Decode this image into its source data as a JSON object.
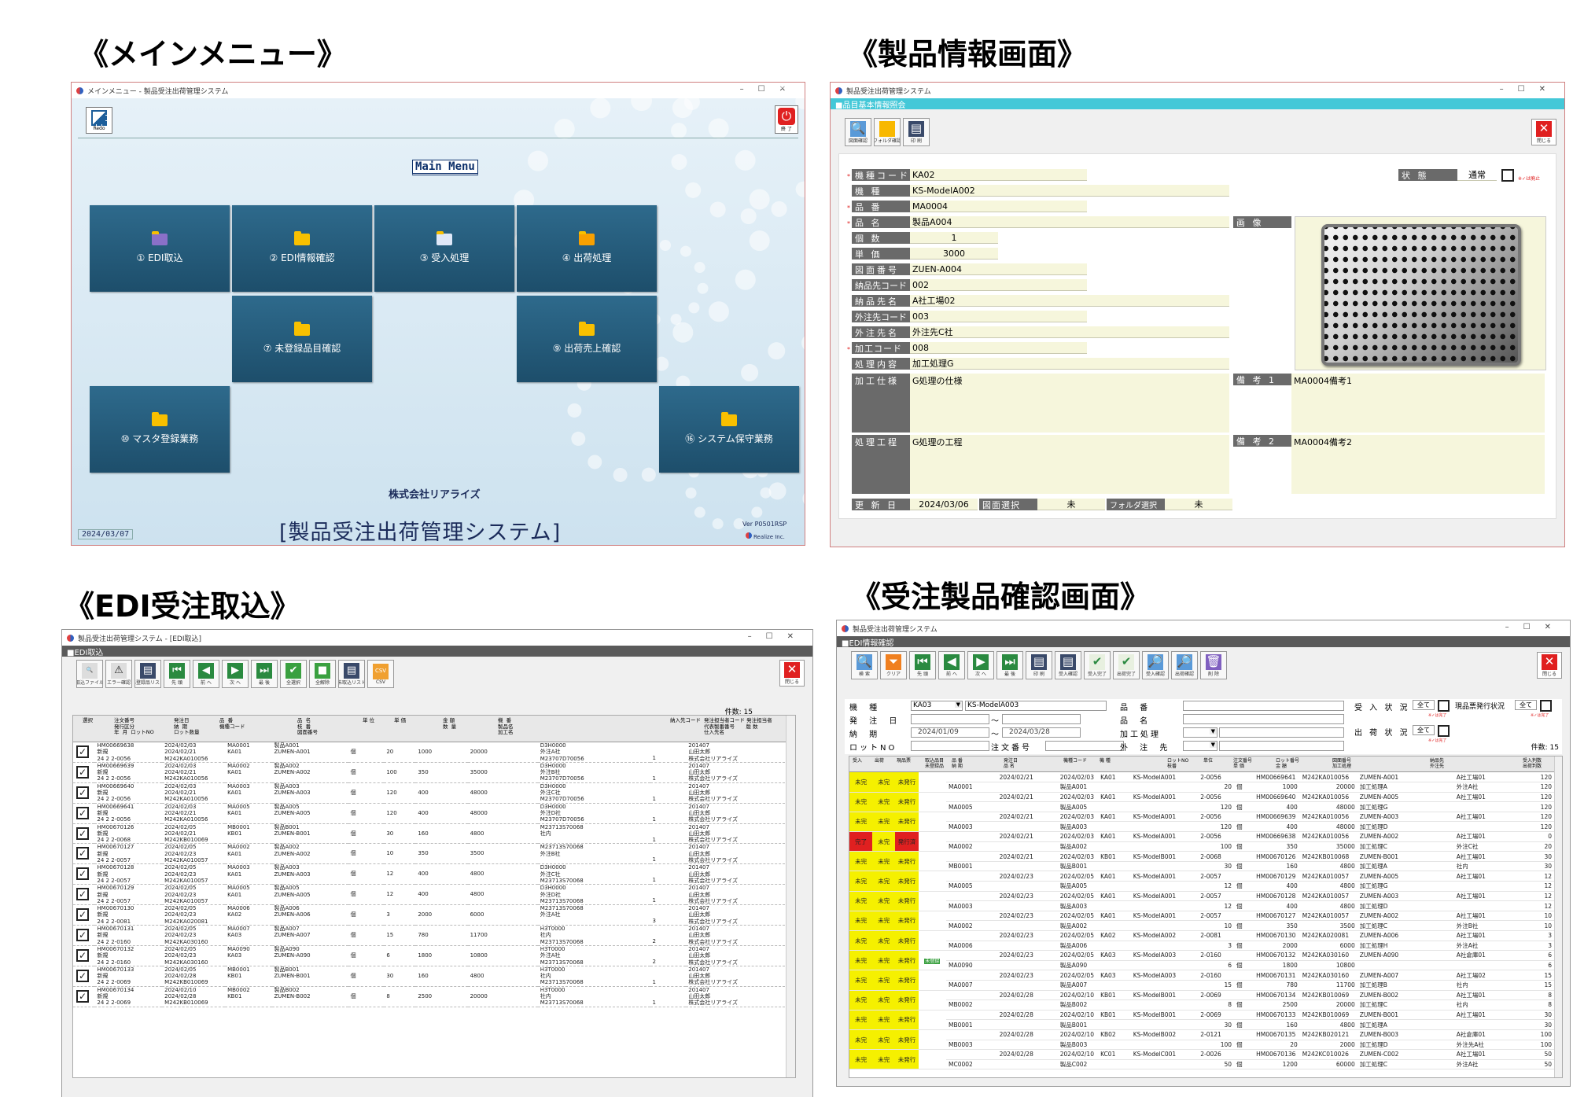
{
  "headings": {
    "main_menu": "《メインメニュー》",
    "product_info": "《製品情報画面》",
    "edi": "《EDI受注取込》",
    "confirm": "《受注製品確認画面》"
  },
  "main_menu": {
    "title": "メインメニュー - 製品受注出荷管理システム",
    "redo_label": "Redo",
    "exit_label": "終 了",
    "heading": "Main Menu",
    "tiles": [
      "① EDI取込",
      "② EDI情報確認",
      "③ 受入処理",
      "④ 出荷処理",
      "⑦ 未登録品目確認",
      "⑨ 出荷売上確認",
      "⑩ マスタ登録業務",
      "⑯ システム保守業務"
    ],
    "company": "株式会社リアライズ",
    "system_name": "[製品受注出荷管理システム]",
    "date": "2024/03/07",
    "version": "Ver P0501RSP",
    "brand": "Realize Inc."
  },
  "product": {
    "title": "製品受注出荷管理システム",
    "section": "■品目基本情報照会",
    "tools": [
      "図面確認",
      "フォルダ確認",
      "印 刷"
    ],
    "close_label": "閉じる",
    "labels": {
      "model_code": "機種コード",
      "model": "機 種",
      "part_no": "品 番",
      "name": "品 名",
      "qty": "個 数",
      "price": "単 価",
      "drawing_no": "図面番号",
      "dest_code": "納品先コード",
      "dest_name": "納品先名",
      "order_code": "外注先コード",
      "order_name": "外注先名",
      "proc_code": "加工コード",
      "proc_content": "処理内容",
      "spec": "加工仕様",
      "process": "処理工程",
      "updated": "更 新 日",
      "drawing_sel": "図面選択",
      "folder_sel": "フォルダ選択",
      "status": "状 態",
      "image": "画 像",
      "note1": "備 考 1",
      "note2": "備 考 2"
    },
    "values": {
      "model_code": "KA02",
      "model": "KS-ModelA002",
      "part_no": "MA0004",
      "name": "製品A004",
      "qty": "1",
      "price": "3000",
      "drawing_no": "ZUEN-A004",
      "dest_code": "002",
      "dest_name": "A社工場02",
      "order_code": "003",
      "order_name": "外注先C社",
      "proc_code": "008",
      "proc_content": "加工処理G",
      "spec": "G処理の仕様",
      "process": "G処理の工程",
      "updated": "2024/03/06",
      "drawing_sel": "未",
      "folder_sel": "未",
      "status": "通常",
      "status_note": "※✓は廃止",
      "note1": "MA0004備考1",
      "note2": "MA0004備考2"
    }
  },
  "edi": {
    "title": "製品受注出荷管理システム - [EDI取込]",
    "section": "■EDI取込",
    "tools": [
      "取込ファイル",
      "エラー確認",
      "未登録品リスト",
      "先 頭",
      "前 へ",
      "次 へ",
      "最 後",
      "全選択",
      "全解除",
      "未取込リスト",
      "CSV",
      "閉じる"
    ],
    "count": "件数: 15",
    "header_top": [
      "選択",
      "注文番号\n発行区分\n年  月  ロットNO",
      "発注日\n納  期\nロット数量",
      "品  番\n機種コード",
      "品  名\n枝  番\n図面番号",
      "単 位",
      "単 価",
      "金 額\n数  量",
      "機  番\n製品名\n加工名",
      "納入先コード",
      "発注担当者コード 発注担当者\n代表製番番号       版 数\n仕入先名"
    ],
    "rows": [
      [
        "HM00669638",
        "新規",
        "24  2  2-0056",
        "2024/02/03",
        "2024/02/21",
        "M242KA010056",
        "MA0001",
        "KA01",
        "製品A001",
        "ZUMEN-A001",
        "20",
        "1000",
        "20000",
        "D3H0000",
        "外注A社",
        "M23707D70056",
        "201407",
        "山田太郎",
        "株式会社リアライズ",
        "1",
        "2"
      ],
      [
        "HM00669639",
        "新規",
        "24  2  2-0056",
        "2024/02/03",
        "2024/02/21",
        "M242KA010056",
        "MA0002",
        "KA01",
        "製品A002",
        "ZUMEN-A002",
        "100",
        "350",
        "35000",
        "D3H0000",
        "外注B社",
        "M23707D70056",
        "201407",
        "山田太郎",
        "株式会社リアライズ",
        "1",
        "3"
      ],
      [
        "HM00669640",
        "新規",
        "24  2  2-0056",
        "2024/02/03",
        "2024/02/21",
        "M242KA010056",
        "MA0003",
        "KA01",
        "製品A003",
        "ZUMEN-A003",
        "120",
        "400",
        "48000",
        "D3H0000",
        "外注C社",
        "M23707D70056",
        "201407",
        "山田太郎",
        "株式会社リアライズ",
        "1",
        "2"
      ],
      [
        "HM00669641",
        "新規",
        "24  2  2-0056",
        "2024/02/03",
        "2024/02/21",
        "M242KA010056",
        "MA0005",
        "KA01",
        "製品A005",
        "ZUMEN-A005",
        "120",
        "400",
        "48000",
        "D3H0000",
        "外注D社",
        "M23707D70056",
        "201407",
        "山田太郎",
        "株式会社リアライズ",
        "1",
        "3"
      ],
      [
        "HM00670126",
        "新規",
        "24  2  2-0068",
        "2024/02/05",
        "2024/02/21",
        "M242KB010069",
        "MB0001",
        "KB01",
        "製品B001",
        "ZUMEN-B001",
        "30",
        "160",
        "4800",
        "M23713S70068",
        "社内",
        "",
        "201407",
        "山田太郎",
        "株式会社リアライズ",
        "1",
        "1"
      ],
      [
        "HM00670127",
        "新規",
        "24  2  2-0057",
        "2024/02/05",
        "2024/02/23",
        "M242KA010057",
        "MA0002",
        "KA01",
        "製品A002",
        "ZUMEN-A002",
        "10",
        "350",
        "3500",
        "M23713S70068",
        "外注B社",
        "",
        "201407",
        "山田太郎",
        "株式会社リアライズ",
        "1",
        "3"
      ],
      [
        "HM00670128",
        "新規",
        "24  2  2-0057",
        "2024/02/05",
        "2024/02/23",
        "M242KA010057",
        "MA0003",
        "KA01",
        "製品A003",
        "ZUMEN-A003",
        "12",
        "400",
        "4800",
        "D3H0000",
        "外注C社",
        "M23713S70068",
        "201407",
        "山田太郎",
        "株式会社リアライズ",
        "1",
        "2"
      ],
      [
        "HM00670129",
        "新規",
        "24  2  2-0057",
        "2024/02/05",
        "2024/02/23",
        "M242KA010057",
        "MA0005",
        "KA01",
        "製品A005",
        "ZUMEN-A005",
        "12",
        "400",
        "4800",
        "D3H0000",
        "外注D社",
        "M23713S70068",
        "201407",
        "山田太郎",
        "株式会社リアライズ",
        "1",
        "3"
      ],
      [
        "HM00670130",
        "新規",
        "24  2  2-0081",
        "2024/02/05",
        "2024/02/23",
        "M242KA020081",
        "MA0006",
        "KA02",
        "製品A006",
        "ZUMEN-A006",
        "3",
        "2000",
        "6000",
        "M23713S70068",
        "外注A社",
        "",
        "201407",
        "山田太郎",
        "株式会社リアライズ",
        "3",
        "1"
      ],
      [
        "HM00670131",
        "新規",
        "24  2  2-0160",
        "2024/02/05",
        "2024/02/23",
        "M242KA030160",
        "MA0007",
        "KA03",
        "製品A007",
        "ZUMEN-A007",
        "15",
        "780",
        "11700",
        "H3T0000",
        "社内",
        "M23713S70068",
        "201407",
        "山田太郎",
        "株式会社リアライズ",
        "2",
        "1"
      ],
      [
        "HM00670132",
        "新規",
        "24  2  2-0160",
        "2024/02/05",
        "2024/02/23",
        "M242KA030160",
        "MA0090",
        "KA03",
        "製品A090",
        "ZUMEN-A090",
        "6",
        "1800",
        "10800",
        "H3T0000",
        "外注A社",
        "M23713S70068",
        "201407",
        "山田太郎",
        "株式会社リアライズ",
        "2",
        "1"
      ],
      [
        "HM00670133",
        "新規",
        "24  2  2-0069",
        "2024/02/05",
        "2024/02/28",
        "M242KB010069",
        "MB0001",
        "KB01",
        "製品B001",
        "ZUMEN-B001",
        "30",
        "160",
        "4800",
        "H3T0000",
        "社内",
        "M23713S70068",
        "201407",
        "山田太郎",
        "株式会社リアライズ",
        "1",
        "1"
      ],
      [
        "HM00670134",
        "新規",
        "24  2  2-0069",
        "2024/02/10",
        "2024/02/28",
        "M242KB010069",
        "MB0002",
        "KB01",
        "製品B002",
        "ZUMEN-B002",
        "8",
        "2500",
        "20000",
        "H3T0000",
        "社内",
        "M23713S70068",
        "201407",
        "山田太郎",
        "株式会社リアライズ",
        "1",
        "1"
      ]
    ]
  },
  "confirm": {
    "title": "製品受注出荷管理システム",
    "section": "■EDI情報確認",
    "tools": [
      "検 索",
      "クリア",
      "先 頭",
      "前 へ",
      "次 へ",
      "最 後",
      "印 刷",
      "受入確認",
      "受入完了",
      "出荷完了",
      "受入確認",
      "出荷確認",
      "削 除",
      "閉じる"
    ],
    "filters": {
      "model_label": "機 種",
      "model_code": "KA03",
      "model_name": "KS-ModelA003",
      "order_date_label": "発 注 日",
      "due_label": "納 期",
      "due_from": "2024/01/09",
      "due_to": "2024/03/28",
      "lot_label": "ロットNO",
      "order_no_label": "注文番号",
      "part_label": "品 番",
      "name_label": "品 名",
      "proc_label": "加工処理",
      "vendor_label": "外 注 先",
      "recv_label": "受 入 状 況",
      "recv_val": "全て",
      "ship_label": "出 荷 状 況",
      "ship_val": "全て",
      "slip_label": "現品票発行状況",
      "slip_val": "全て",
      "note": "※✓は完了",
      "count": "件数: 15"
    },
    "headers": [
      "受入",
      "出荷",
      "現品票",
      "取込品目\n未登録品",
      "品 番\n納 期",
      "発注日\n品 名",
      "機種コード",
      "機 種",
      "ロットNO\n枝番",
      "単位",
      "注文番号\n単 価",
      "ロット番号\n金 額",
      "図面番号\n加工処理",
      "納品先\n外注先",
      "受入判数\n出荷判数"
    ],
    "rows": [
      [
        "未完",
        "未完",
        "未発行",
        "",
        "2024/02/21",
        "MA0001",
        "2024/02/03",
        "製品A001",
        "KA01",
        "KS-ModelA001",
        "2-0056",
        "20",
        "個",
        "HM00669641",
        "1000",
        "M242KA010056",
        "20000",
        "ZUMEN-A001",
        "加工処理A",
        "A社工場01",
        "外注A社",
        "120",
        "120"
      ],
      [
        "未完",
        "未完",
        "未発行",
        "",
        "2024/02/21",
        "MA0005",
        "2024/02/03",
        "製品A005",
        "KA01",
        "KS-ModelA001",
        "2-0056",
        "120",
        "個",
        "HM00669640",
        "400",
        "M242KA010056",
        "48000",
        "ZUMEN-A005",
        "加工処理G",
        "A社工場01",
        "",
        "120",
        "120"
      ],
      [
        "未完",
        "未完",
        "未発行",
        "",
        "2024/02/21",
        "MA0003",
        "2024/02/03",
        "製品A003",
        "KA01",
        "KS-ModelA001",
        "2-0056",
        "120",
        "個",
        "HM00669639",
        "400",
        "M242KA010056",
        "48000",
        "ZUMEN-A003",
        "加工処理D",
        "A社工場01",
        "",
        "120",
        "120"
      ],
      [
        "完了",
        "未完",
        "発行済",
        "",
        "2024/02/21",
        "MA0002",
        "2024/02/03",
        "製品A002",
        "KA01",
        "KS-ModelA001",
        "2-0056",
        "100",
        "個",
        "HM00669638",
        "350",
        "M242KA010056",
        "35000",
        "ZUMEN-A002",
        "加工処理C",
        "A社工場01",
        "外注C社",
        "0",
        "20"
      ],
      [
        "未完",
        "未完",
        "未発行",
        "",
        "2024/02/21",
        "MB0001",
        "2024/02/03",
        "製品B001",
        "KB01",
        "KS-ModelB001",
        "2-0068",
        "30",
        "個",
        "HM00670126",
        "160",
        "M242KB010068",
        "4800",
        "ZUMEN-B001",
        "加工処理A",
        "A社工場01",
        "社内",
        "30",
        "30"
      ],
      [
        "未完",
        "未完",
        "未発行",
        "",
        "2024/02/23",
        "MA0005",
        "2024/02/05",
        "製品A005",
        "KA01",
        "KS-ModelA001",
        "2-0057",
        "12",
        "個",
        "HM00670129",
        "400",
        "M242KA010057",
        "4800",
        "ZUMEN-A005",
        "加工処理G",
        "A社工場01",
        "",
        "12",
        "12"
      ],
      [
        "未完",
        "未完",
        "未発行",
        "",
        "2024/02/23",
        "MA0003",
        "2024/02/05",
        "製品A003",
        "KA01",
        "KS-ModelA001",
        "2-0057",
        "12",
        "個",
        "HM00670128",
        "400",
        "M242KA010057",
        "4800",
        "ZUMEN-A003",
        "加工処理D",
        "A社工場01",
        "",
        "12",
        "12"
      ],
      [
        "未完",
        "未完",
        "未発行",
        "",
        "2024/02/23",
        "MA0002",
        "2024/02/05",
        "製品A002",
        "KA01",
        "KS-ModelA001",
        "2-0057",
        "10",
        "個",
        "HM00670127",
        "350",
        "M242KA010057",
        "3500",
        "ZUMEN-A002",
        "加工処理C",
        "A社工場01",
        "外注B社",
        "10",
        "10"
      ],
      [
        "未完",
        "未完",
        "未発行",
        "",
        "2024/02/23",
        "MA0006",
        "2024/02/05",
        "製品A006",
        "KA02",
        "KS-ModelA002",
        "2-0081",
        "3",
        "個",
        "HM00670130",
        "2000",
        "M242KA020081",
        "6000",
        "ZUMEN-A006",
        "加工処理H",
        "A社工場01",
        "外注A社",
        "3",
        "3"
      ],
      [
        "未完",
        "未完",
        "未発行",
        "未登録",
        "2024/02/23",
        "MA0090",
        "2024/02/05",
        "製品A090",
        "KA03",
        "KS-ModelA003",
        "2-0160",
        "6",
        "個",
        "HM00670132",
        "1800",
        "M242KA030160",
        "10800",
        "ZUMEN-A090",
        "",
        "A社倉庫01",
        "",
        "6",
        "6"
      ],
      [
        "未完",
        "未完",
        "未発行",
        "",
        "2024/02/23",
        "MA0007",
        "2024/02/05",
        "製品A007",
        "KA03",
        "KS-ModelA003",
        "2-0160",
        "15",
        "個",
        "HM00670131",
        "780",
        "M242KA030160",
        "11700",
        "ZUMEN-A007",
        "加工処理B",
        "A社工場02",
        "社内",
        "15",
        "15"
      ],
      [
        "未完",
        "未完",
        "未発行",
        "",
        "2024/02/28",
        "MB0002",
        "2024/02/10",
        "製品B002",
        "KB01",
        "KS-ModelB001",
        "2-0069",
        "8",
        "個",
        "HM00670134",
        "2500",
        "M242KB010069",
        "20000",
        "ZUMEN-B002",
        "加工処理C",
        "A社工場01",
        "社内",
        "8",
        "8"
      ],
      [
        "未完",
        "未完",
        "未発行",
        "",
        "2024/02/28",
        "MB0001",
        "2024/02/10",
        "製品B001",
        "KB01",
        "KS-ModelB001",
        "2-0069",
        "30",
        "個",
        "HM00670133",
        "160",
        "M242KB010069",
        "4800",
        "ZUMEN-B001",
        "加工処理A",
        "A社工場01",
        "",
        "30",
        "30"
      ],
      [
        "未完",
        "未完",
        "未発行",
        "",
        "2024/02/28",
        "MB0003",
        "2024/02/10",
        "製品B003",
        "KB02",
        "KS-ModelB002",
        "2-0121",
        "100",
        "個",
        "HM00670135",
        "20",
        "M242KB020121",
        "2000",
        "ZUMEN-B003",
        "加工処理D",
        "A社倉庫01",
        "外注先A社",
        "100",
        "100"
      ],
      [
        "未完",
        "未完",
        "未発行",
        "",
        "2024/02/28",
        "MC0002",
        "2024/02/10",
        "製品C002",
        "KC01",
        "KS-ModelC001",
        "2-0026",
        "50",
        "個",
        "HM00670136",
        "1200",
        "M242KC010026",
        "60000",
        "ZUMEN-C002",
        "加工処理C",
        "A社工場01",
        "外注A社",
        "50",
        "50"
      ]
    ]
  }
}
